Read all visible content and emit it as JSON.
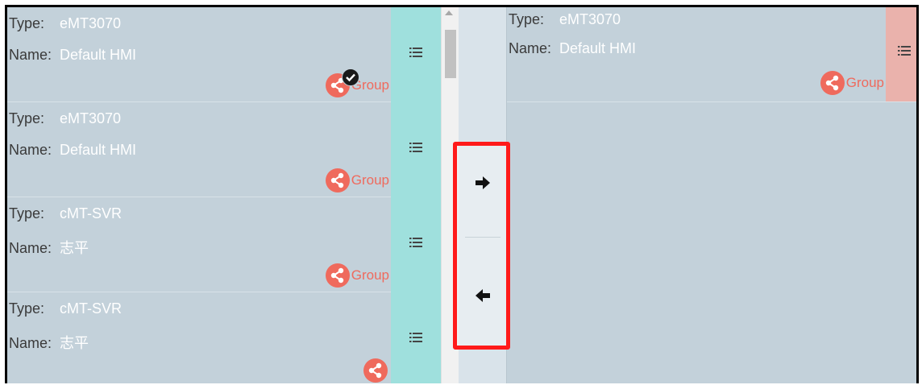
{
  "labels": {
    "type": "Type:",
    "name": "Name:"
  },
  "group_label": "Group",
  "colors": {
    "panel_bg": "#c3d1da",
    "menu_tab_teal": "#9fe0dd",
    "menu_tab_pink": "#eab2ac",
    "group_accent": "#ef6a5d",
    "highlight_border": "#ff1a1a"
  },
  "left_devices": [
    {
      "type": "eMT3070",
      "name": "Default HMI",
      "group": "Group",
      "selected": true
    },
    {
      "type": "eMT3070",
      "name": "Default HMI",
      "group": "Group",
      "selected": false
    },
    {
      "type": "cMT-SVR",
      "name": "志平",
      "group": "Group",
      "selected": false
    },
    {
      "type": "cMT-SVR",
      "name": "志平",
      "group": "",
      "selected": false
    }
  ],
  "right_devices": [
    {
      "type": "eMT3070",
      "name": "Default HMI",
      "group": "Group"
    }
  ],
  "transfer": {
    "move_right_icon": "arrow-right-icon",
    "move_left_icon": "arrow-left-icon"
  }
}
